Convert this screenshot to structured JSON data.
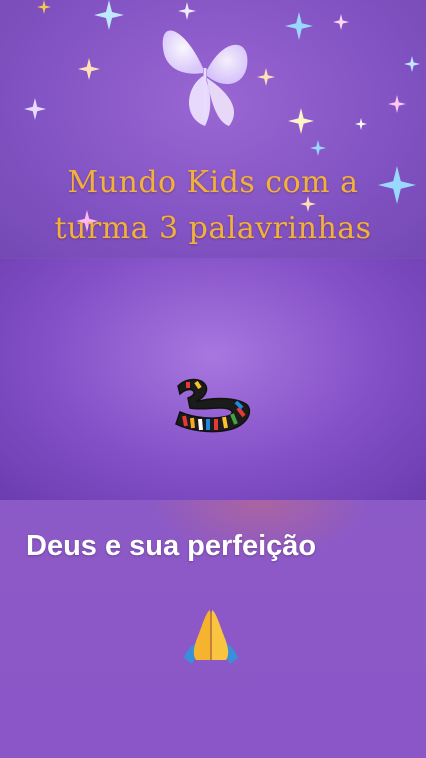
{
  "story": {
    "title_line1": "Mundo Kids com a",
    "title_line2": "turma 3 palavrinhas",
    "caption": "Deus e sua perfeição"
  },
  "icons": {
    "butterfly": "butterfly-icon",
    "logo": "number-three-logo",
    "pray": "praying-hands-icon",
    "sparkles": "sparkle-icon"
  },
  "colors": {
    "background": "#8a55c6",
    "title": "#f2b13b",
    "caption": "#ffffff"
  }
}
